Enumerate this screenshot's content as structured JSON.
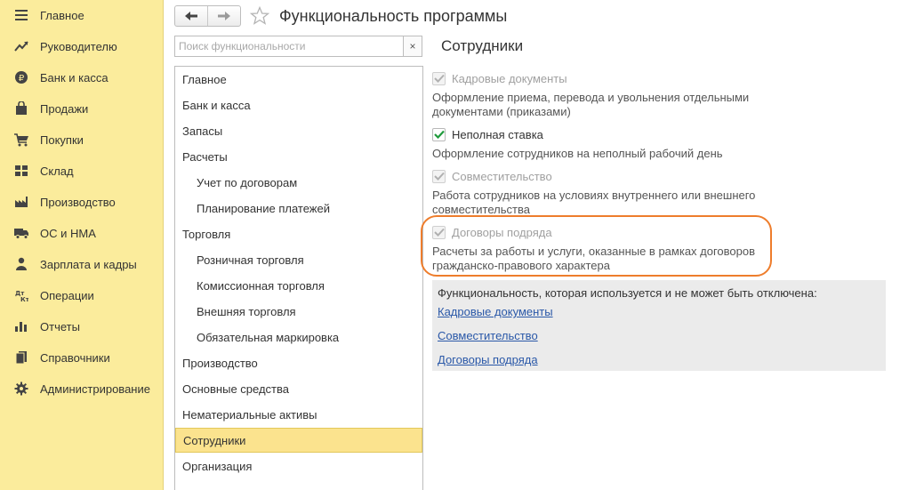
{
  "sidebar": {
    "items": [
      {
        "label": "Главное",
        "icon": "menu-icon"
      },
      {
        "label": "Руководителю",
        "icon": "trend-icon"
      },
      {
        "label": "Банк и касса",
        "icon": "ruble-coin-icon"
      },
      {
        "label": "Продажи",
        "icon": "shopping-bag-icon"
      },
      {
        "label": "Покупки",
        "icon": "cart-icon"
      },
      {
        "label": "Склад",
        "icon": "warehouse-grid-icon"
      },
      {
        "label": "Производство",
        "icon": "factory-icon"
      },
      {
        "label": "ОС и НМА",
        "icon": "truck-icon"
      },
      {
        "label": "Зарплата и кадры",
        "icon": "person-icon"
      },
      {
        "label": "Операции",
        "icon": "debit-credit-icon"
      },
      {
        "label": "Отчеты",
        "icon": "bar-chart-icon"
      },
      {
        "label": "Справочники",
        "icon": "books-icon"
      },
      {
        "label": "Администрирование",
        "icon": "gear-icon"
      }
    ]
  },
  "header": {
    "title": "Функциональность программы"
  },
  "search": {
    "placeholder": "Поиск функциональности",
    "clear_label": "×"
  },
  "sections": {
    "items": [
      {
        "label": "Главное",
        "level": 0
      },
      {
        "label": "Банк и касса",
        "level": 0
      },
      {
        "label": "Запасы",
        "level": 0
      },
      {
        "label": "Расчеты",
        "level": 0
      },
      {
        "label": "Учет по договорам",
        "level": 1
      },
      {
        "label": "Планирование платежей",
        "level": 1
      },
      {
        "label": "Торговля",
        "level": 0
      },
      {
        "label": "Розничная торговля",
        "level": 1
      },
      {
        "label": "Комиссионная торговля",
        "level": 1
      },
      {
        "label": "Внешняя торговля",
        "level": 1
      },
      {
        "label": "Обязательная маркировка",
        "level": 1
      },
      {
        "label": "Производство",
        "level": 0
      },
      {
        "label": "Основные средства",
        "level": 0
      },
      {
        "label": "Нематериальные активы",
        "level": 0
      },
      {
        "label": "Сотрудники",
        "level": 0,
        "selected": true
      },
      {
        "label": "Организация",
        "level": 0
      }
    ]
  },
  "main": {
    "section_title": "Сотрудники",
    "options": [
      {
        "label": "Кадровые документы",
        "checked": true,
        "disabled": true,
        "description": "Оформление приема, перевода и увольнения отдельными документами (приказами)"
      },
      {
        "label": "Неполная ставка",
        "checked": true,
        "disabled": false,
        "description": "Оформление сотрудников на неполный рабочий день"
      },
      {
        "label": "Совместительство",
        "checked": true,
        "disabled": true,
        "description": "Работа сотрудников на условиях внутреннего или внешнего совместительства"
      },
      {
        "label": "Договоры подряда",
        "checked": true,
        "disabled": true,
        "description": "Расчеты за работы и услуги, оказанные в рамках договоров гражданско-правового характера"
      }
    ],
    "info": {
      "title": "Функциональность, которая используется и не может быть отключена:",
      "links": [
        "Кадровые документы",
        "Совместительство",
        "Договоры подряда"
      ]
    }
  },
  "colors": {
    "sidebar_bg": "#fbec9c",
    "selected_bg": "#fbe38e",
    "highlight_border": "#ee7d2c",
    "link": "#2a58a8",
    "check_enabled": "#1f9a3c",
    "check_disabled": "#b0b0b0"
  }
}
